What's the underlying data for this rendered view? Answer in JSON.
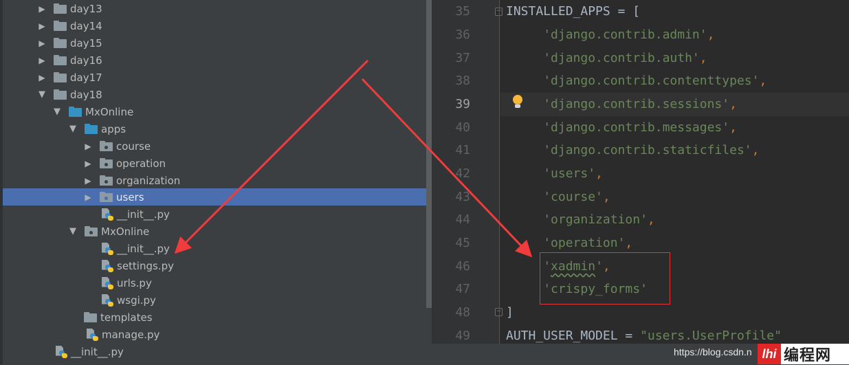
{
  "project_tree": {
    "items": [
      {
        "label": "day13",
        "type": "folder",
        "expanded": false,
        "selected": false
      },
      {
        "label": "day14",
        "type": "folder",
        "expanded": false,
        "selected": false
      },
      {
        "label": "day15",
        "type": "folder",
        "expanded": false,
        "selected": false
      },
      {
        "label": "day16",
        "type": "folder",
        "expanded": false,
        "selected": false
      },
      {
        "label": "day17",
        "type": "folder",
        "expanded": false,
        "selected": false
      },
      {
        "label": "day18",
        "type": "folder",
        "expanded": true,
        "selected": false
      },
      {
        "label": "MxOnline",
        "type": "source-folder",
        "expanded": true,
        "selected": false
      },
      {
        "label": "apps",
        "type": "source-folder",
        "expanded": true,
        "selected": false
      },
      {
        "label": "course",
        "type": "package",
        "expanded": false,
        "selected": false
      },
      {
        "label": "operation",
        "type": "package",
        "expanded": false,
        "selected": false
      },
      {
        "label": "organization",
        "type": "package",
        "expanded": false,
        "selected": false
      },
      {
        "label": "users",
        "type": "package",
        "expanded": false,
        "selected": true
      },
      {
        "label": "__init__.py",
        "type": "python-file",
        "selected": false
      },
      {
        "label": "MxOnline",
        "type": "package",
        "expanded": true,
        "selected": false
      },
      {
        "label": "__init__.py",
        "type": "python-file",
        "selected": false
      },
      {
        "label": "settings.py",
        "type": "python-file",
        "selected": false
      },
      {
        "label": "urls.py",
        "type": "python-file",
        "selected": false
      },
      {
        "label": "wsgi.py",
        "type": "python-file",
        "selected": false
      },
      {
        "label": "templates",
        "type": "folder",
        "selected": false
      },
      {
        "label": "manage.py",
        "type": "python-file",
        "selected": false
      },
      {
        "label": "__init__.py",
        "type": "python-file",
        "selected": false
      }
    ]
  },
  "editor": {
    "current_line": "39",
    "lines": [
      {
        "num": "35",
        "code": "INSTALLED_APPS = ["
      },
      {
        "num": "36",
        "str": "'django.contrib.admin'",
        "suffix": ","
      },
      {
        "num": "37",
        "str": "'django.contrib.auth'",
        "suffix": ","
      },
      {
        "num": "38",
        "str": "'django.contrib.contenttypes'",
        "suffix": ","
      },
      {
        "num": "39",
        "str": "'django.contrib.sessions'",
        "suffix": ","
      },
      {
        "num": "40",
        "str": "'django.contrib.messages'",
        "suffix": ","
      },
      {
        "num": "41",
        "str": "'django.contrib.staticfiles'",
        "suffix": ","
      },
      {
        "num": "42",
        "str": "'users'",
        "suffix": ","
      },
      {
        "num": "43",
        "str": "'course'",
        "suffix": ","
      },
      {
        "num": "44",
        "str": "'organization'",
        "suffix": ","
      },
      {
        "num": "45",
        "str": "'operation'",
        "suffix": ","
      },
      {
        "num": "46",
        "str_open": "'",
        "str_word": "xadmin",
        "str_close": "'",
        "suffix": ","
      },
      {
        "num": "47",
        "str": "'crispy_forms'",
        "suffix": ""
      },
      {
        "num": "48",
        "code": "]"
      },
      {
        "num": "49",
        "code": "AUTH_USER_MODEL = ",
        "str": "\"users.UserProfile\""
      }
    ]
  },
  "annotations": {
    "highlight_color": "#e0393e"
  },
  "watermark": {
    "url": "https://blog.csdn.n",
    "badge": "lhi",
    "site": "编程网"
  },
  "colors": {
    "selection": "#4b6eaf",
    "string": "#6a8759",
    "keyword_punct": "#cc7832",
    "identifier": "#a9b7c6"
  }
}
